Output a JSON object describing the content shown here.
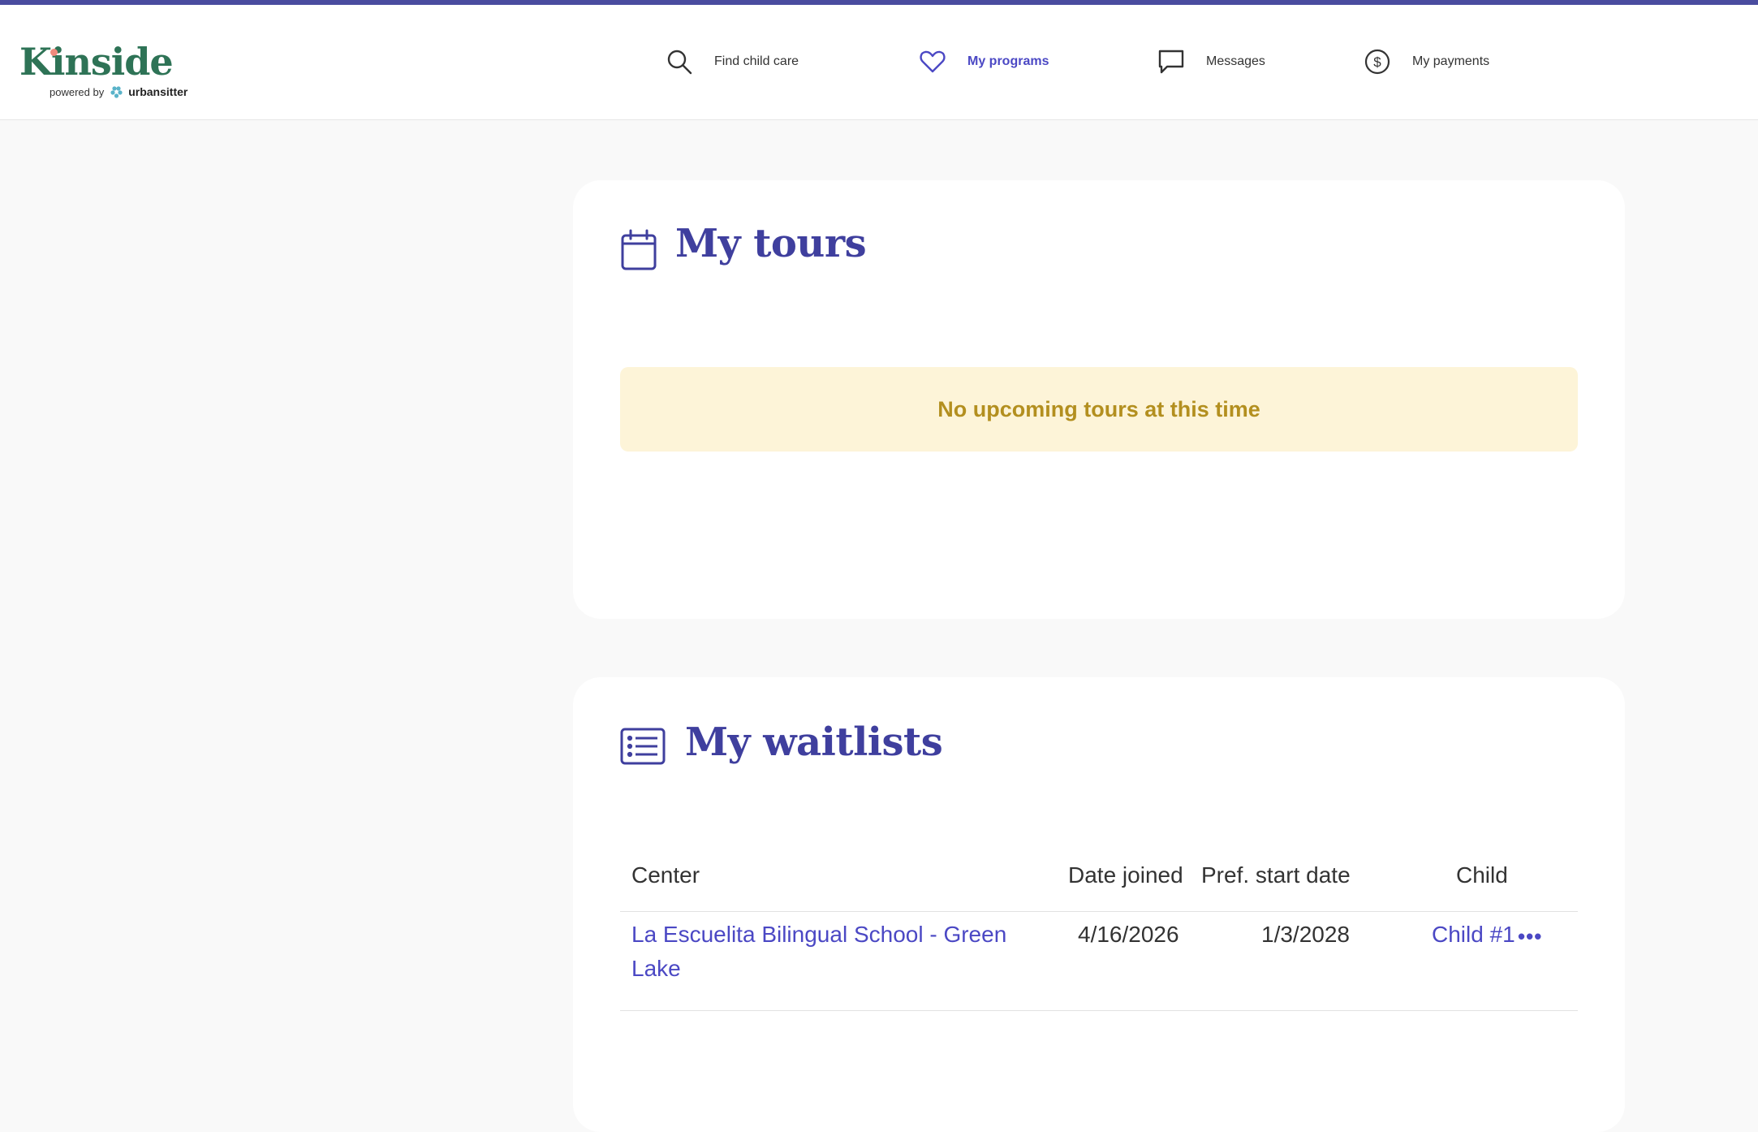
{
  "brand": {
    "name": "Kinside",
    "powered_by": "powered by",
    "partner": "urbansitter",
    "colors": {
      "primary": "#4b48c4",
      "logo_green": "#2e7356",
      "accent_bar": "#4a4c9f",
      "notice_bg": "#fdf4d8",
      "notice_text": "#b38f1f"
    }
  },
  "nav": {
    "items": [
      {
        "label": "Find child care",
        "icon": "search-icon",
        "active": false
      },
      {
        "label": "My programs",
        "icon": "heart-icon",
        "active": true
      },
      {
        "label": "Messages",
        "icon": "chat-bubble-icon",
        "active": false
      },
      {
        "label": "My payments",
        "icon": "dollar-circle-icon",
        "active": false
      }
    ]
  },
  "tours": {
    "title": "My tours",
    "icon": "calendar-icon",
    "empty_message": "No upcoming tours at this time"
  },
  "waitlists": {
    "title": "My waitlists",
    "icon": "list-icon",
    "columns": [
      "Center",
      "Date joined",
      "Pref. start date",
      "Child"
    ],
    "rows": [
      {
        "center_line1": "La Escuelita Bilingual School - Green",
        "center_line2": "Lake",
        "date_joined": "4/16/2026",
        "pref_start_date": "1/3/2028",
        "child": "Child #1",
        "more_icon": "more-horizontal-icon"
      }
    ]
  }
}
